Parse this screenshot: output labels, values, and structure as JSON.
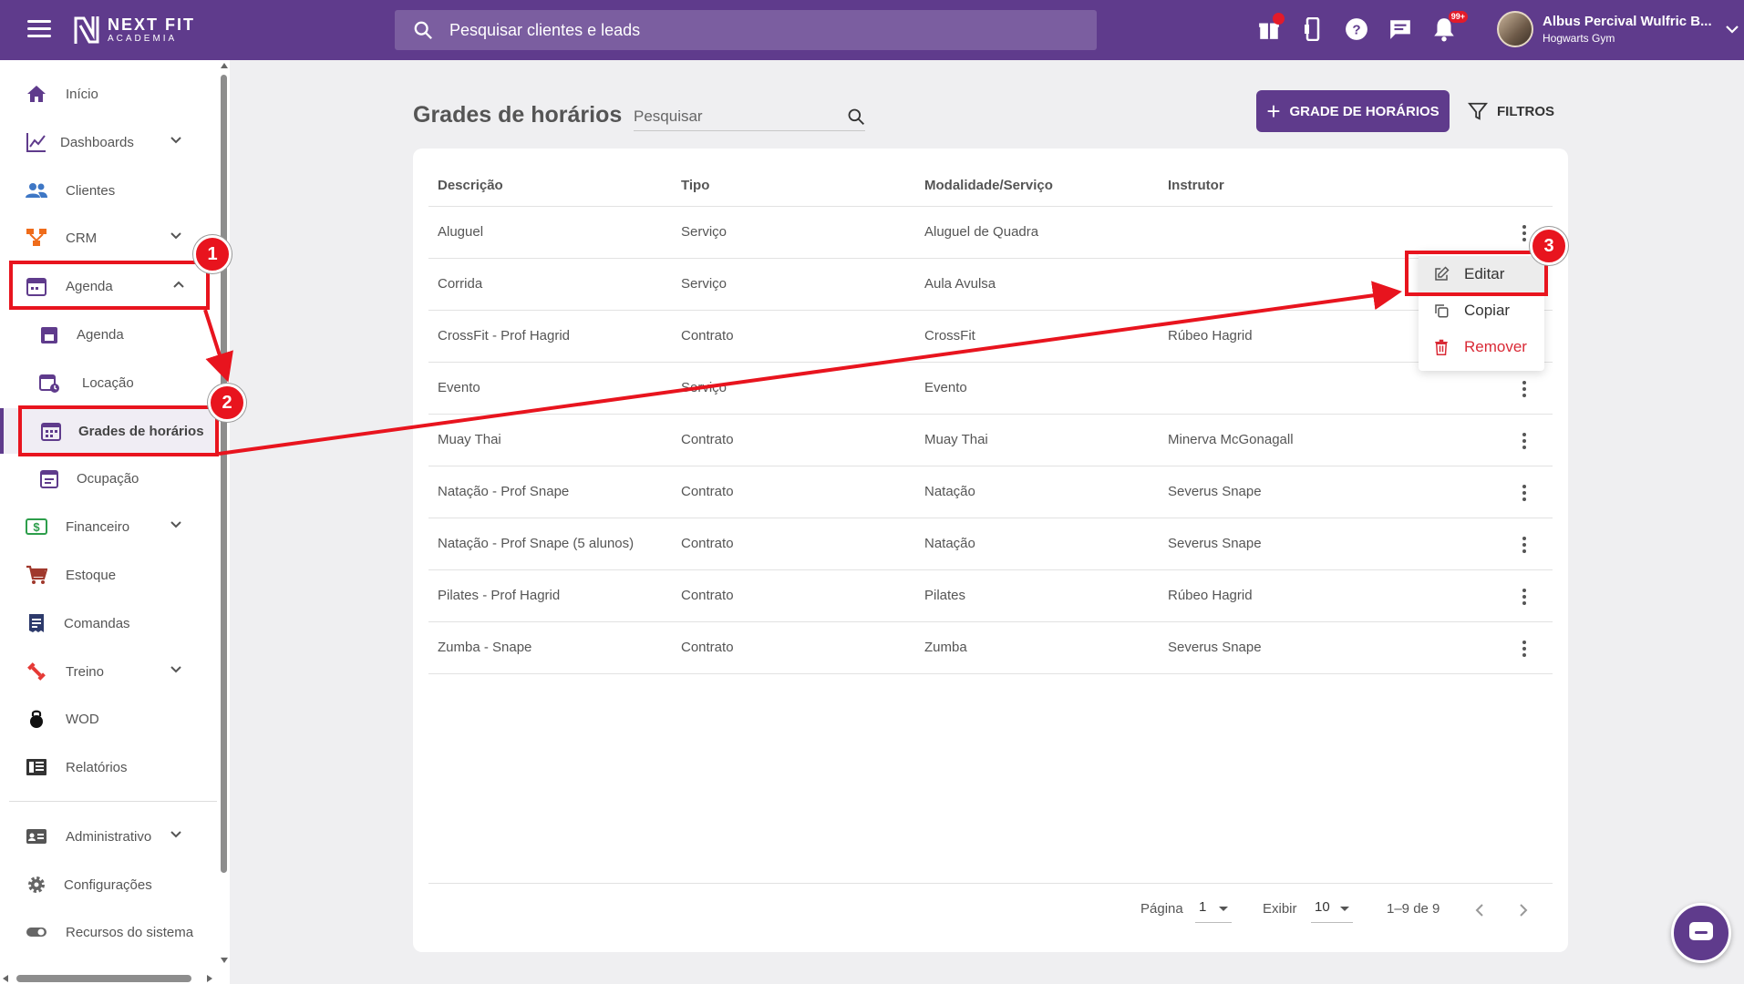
{
  "app": {
    "brand_main": "NEXT FIT",
    "brand_sub": "ACADEMIA",
    "search_placeholder": "Pesquisar clientes e leads",
    "notification_badge": "99+",
    "user_name": "Albus Percival Wulfric B...",
    "user_gym": "Hogwarts Gym"
  },
  "sidebar": {
    "inicio": "Início",
    "dashboards": "Dashboards",
    "clientes": "Clientes",
    "crm": "CRM",
    "agenda": "Agenda",
    "agenda_sub": "Agenda",
    "locacao": "Locação",
    "grades": "Grades de horários",
    "ocupacao": "Ocupação",
    "financeiro": "Financeiro",
    "estoque": "Estoque",
    "comandas": "Comandas",
    "treino": "Treino",
    "wod": "WOD",
    "relatorios": "Relatórios",
    "administrativo": "Administrativo",
    "configuracoes": "Configurações",
    "recursos": "Recursos do sistema"
  },
  "main": {
    "title": "Grades de horários",
    "search_placeholder": "Pesquisar",
    "add_button": "GRADE DE HORÁRIOS",
    "filter_button": "FILTROS",
    "columns": [
      "Descrição",
      "Tipo",
      "Modalidade/Serviço",
      "Instrutor"
    ],
    "rows": [
      [
        "Aluguel",
        "Serviço",
        "Aluguel de Quadra",
        ""
      ],
      [
        "Corrida",
        "Serviço",
        "Aula Avulsa",
        ""
      ],
      [
        "CrossFit - Prof Hagrid",
        "Contrato",
        "CrossFit",
        "Rúbeo Hagrid"
      ],
      [
        "Evento",
        "Serviço",
        "Evento",
        ""
      ],
      [
        "Muay Thai",
        "Contrato",
        "Muay Thai",
        "Minerva McGonagall"
      ],
      [
        "Natação - Prof Snape",
        "Contrato",
        "Natação",
        "Severus Snape"
      ],
      [
        "Natação - Prof Snape (5 alunos)",
        "Contrato",
        "Natação",
        "Severus Snape"
      ],
      [
        "Pilates - Prof Hagrid",
        "Contrato",
        "Pilates",
        "Rúbeo Hagrid"
      ],
      [
        "Zumba - Snape",
        "Contrato",
        "Zumba",
        "Severus Snape"
      ]
    ],
    "pagination": {
      "page_label": "Página",
      "page_value": "1",
      "show_label": "Exibir",
      "show_value": "10",
      "range": "1–9 de 9"
    }
  },
  "menu": {
    "edit": "Editar",
    "copy": "Copiar",
    "remove": "Remover"
  },
  "annotations": {
    "step1": "1",
    "step2": "2",
    "step3": "3",
    "color": "#e8141e"
  },
  "colors": {
    "primary": "#5f3b8c",
    "danger": "#d92a36"
  }
}
